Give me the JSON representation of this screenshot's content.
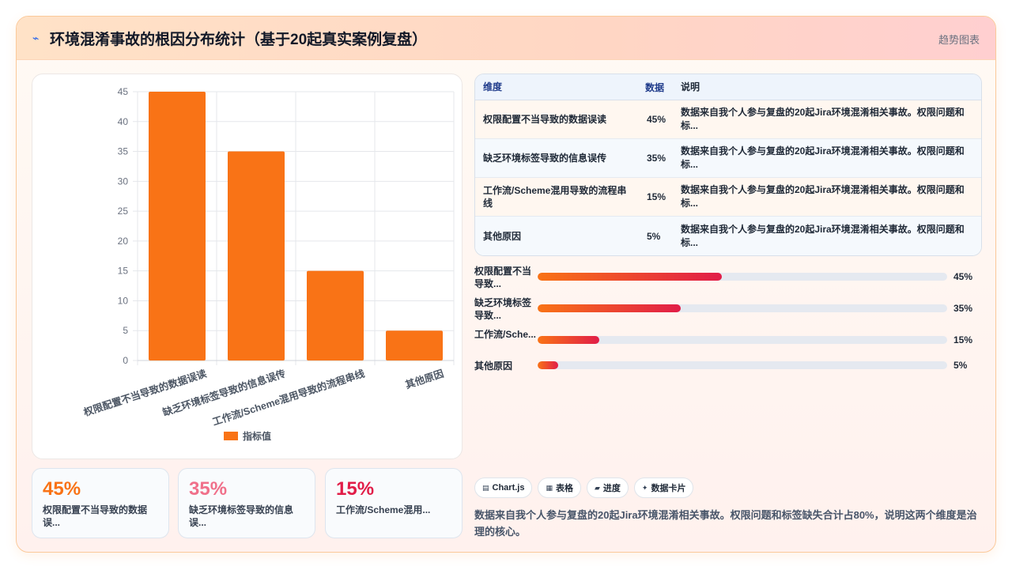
{
  "header": {
    "icon": "chart-icon",
    "title": "环境混淆事故的根因分布统计（基于20起真实案例复盘）",
    "trend_link": "趋势图表"
  },
  "chart_data": {
    "type": "bar",
    "categories": [
      "权限配置不当导致的数据误读",
      "缺乏环境标签导致的信息误传",
      "工作流/Scheme混用导致的流程串线",
      "其他原因"
    ],
    "series": [
      {
        "name": "指标值",
        "values": [
          45,
          35,
          15,
          5
        ],
        "color": "#f97316"
      }
    ],
    "ylim": [
      0,
      45
    ],
    "yticks": [
      0,
      5,
      10,
      15,
      20,
      25,
      30,
      35,
      40,
      45
    ],
    "grid": true,
    "legend": "bottom"
  },
  "table": {
    "headers": [
      "维度",
      "数据",
      "说明"
    ],
    "rows": [
      {
        "dim": "权限配置不当导致的数据误读",
        "value": "45%",
        "note": "数据来自我个人参与复盘的20起Jira环境混淆相关事故。权限问题和标..."
      },
      {
        "dim": "缺乏环境标签导致的信息误传",
        "value": "35%",
        "note": "数据来自我个人参与复盘的20起Jira环境混淆相关事故。权限问题和标..."
      },
      {
        "dim": "工作流/Scheme混用导致的流程串线",
        "value": "15%",
        "note": "数据来自我个人参与复盘的20起Jira环境混淆相关事故。权限问题和标..."
      },
      {
        "dim": "其他原因",
        "value": "5%",
        "note": "数据来自我个人参与复盘的20起Jira环境混淆相关事故。权限问题和标..."
      }
    ]
  },
  "progress": [
    {
      "label": "权限配置不当导致...",
      "value": "45%",
      "fraction": 0.45
    },
    {
      "label": "缺乏环境标签导致...",
      "value": "35%",
      "fraction": 0.35
    },
    {
      "label": "工作流/Sche...",
      "value": "15%",
      "fraction": 0.15
    },
    {
      "label": "其他原因",
      "value": "5%",
      "fraction": 0.05
    }
  ],
  "stats": [
    {
      "value": "45%",
      "label": "权限配置不当导致的数据误...",
      "color": "#f97316"
    },
    {
      "value": "35%",
      "label": "缺乏环境标签导致的信息误...",
      "color": "#f0708a"
    },
    {
      "value": "15%",
      "label": "工作流/Scheme混用...",
      "color": "#e11d48"
    }
  ],
  "chips": [
    {
      "icon": "▤",
      "icon_name": "chart-icon",
      "label": "Chart.js"
    },
    {
      "icon": "▦",
      "icon_name": "table-icon",
      "label": "表格"
    },
    {
      "icon": "▰",
      "icon_name": "progress-icon",
      "label": "进度"
    },
    {
      "icon": "✦",
      "icon_name": "sparkle-icon",
      "label": "数据卡片"
    }
  ],
  "description": "数据来自我个人参与复盘的20起Jira环境混淆相关事故。权限问题和标签缺失合计占80%，说明这两个维度是治理的核心。"
}
